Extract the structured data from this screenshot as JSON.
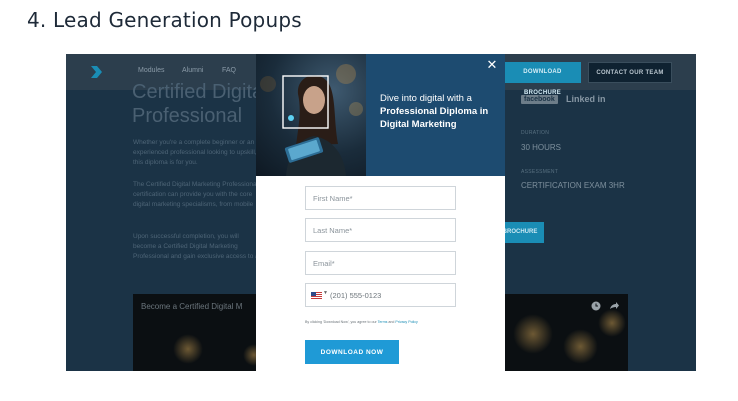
{
  "page_heading": "4. Lead Generation Popups",
  "background_site": {
    "nav": {
      "links": [
        "Modules",
        "Alumni",
        "FAQ"
      ],
      "brochure_button": "DOWNLOAD BROCHURE",
      "contact_button": "CONTACT OUR TEAM"
    },
    "title_line1": "Certified Digital",
    "title_line2": "Professional",
    "paragraphs": [
      "Whether you're a complete beginner or an experienced professional looking to upskill, this diploma is for you.",
      "The Certified Digital Marketing Professional certification can provide you with the core digital marketing specialisms, from mobile marketing to Email marketing, PPC marketing and more.",
      "Upon successful completion, you will become a Certified Digital Marketing Professional and gain exclusive access to a network designed to connect you with peers, employers and more."
    ],
    "social": {
      "facebook": "facebook",
      "linkedin": "Linked in"
    },
    "details": [
      {
        "label": "DURATION",
        "value": "30 HOURS"
      },
      {
        "label": "ASSESSMENT",
        "value": "CERTIFICATION EXAM 3HR"
      }
    ],
    "side_button": "BROCHURE",
    "video_title": "Become a Certified Digital M"
  },
  "popup": {
    "headline_intro": "Dive into digital with a",
    "headline_bold": "Professional Diploma in Digital Marketing",
    "first_name_placeholder": "First Name*",
    "last_name_placeholder": "Last Name*",
    "email_placeholder": "Email*",
    "phone_placeholder": "(201) 555-0123",
    "consent_text": "By clicking 'Download Now', you agree to our",
    "consent_terms": "Terms",
    "consent_and": "and",
    "consent_privacy": "Privacy Policy",
    "submit_label": "DOWNLOAD NOW",
    "close_glyph": "✕"
  },
  "colors": {
    "overlay_bg": "#1b3346",
    "hero_bg": "#1d4b70",
    "accent": "#1f9ad6"
  }
}
